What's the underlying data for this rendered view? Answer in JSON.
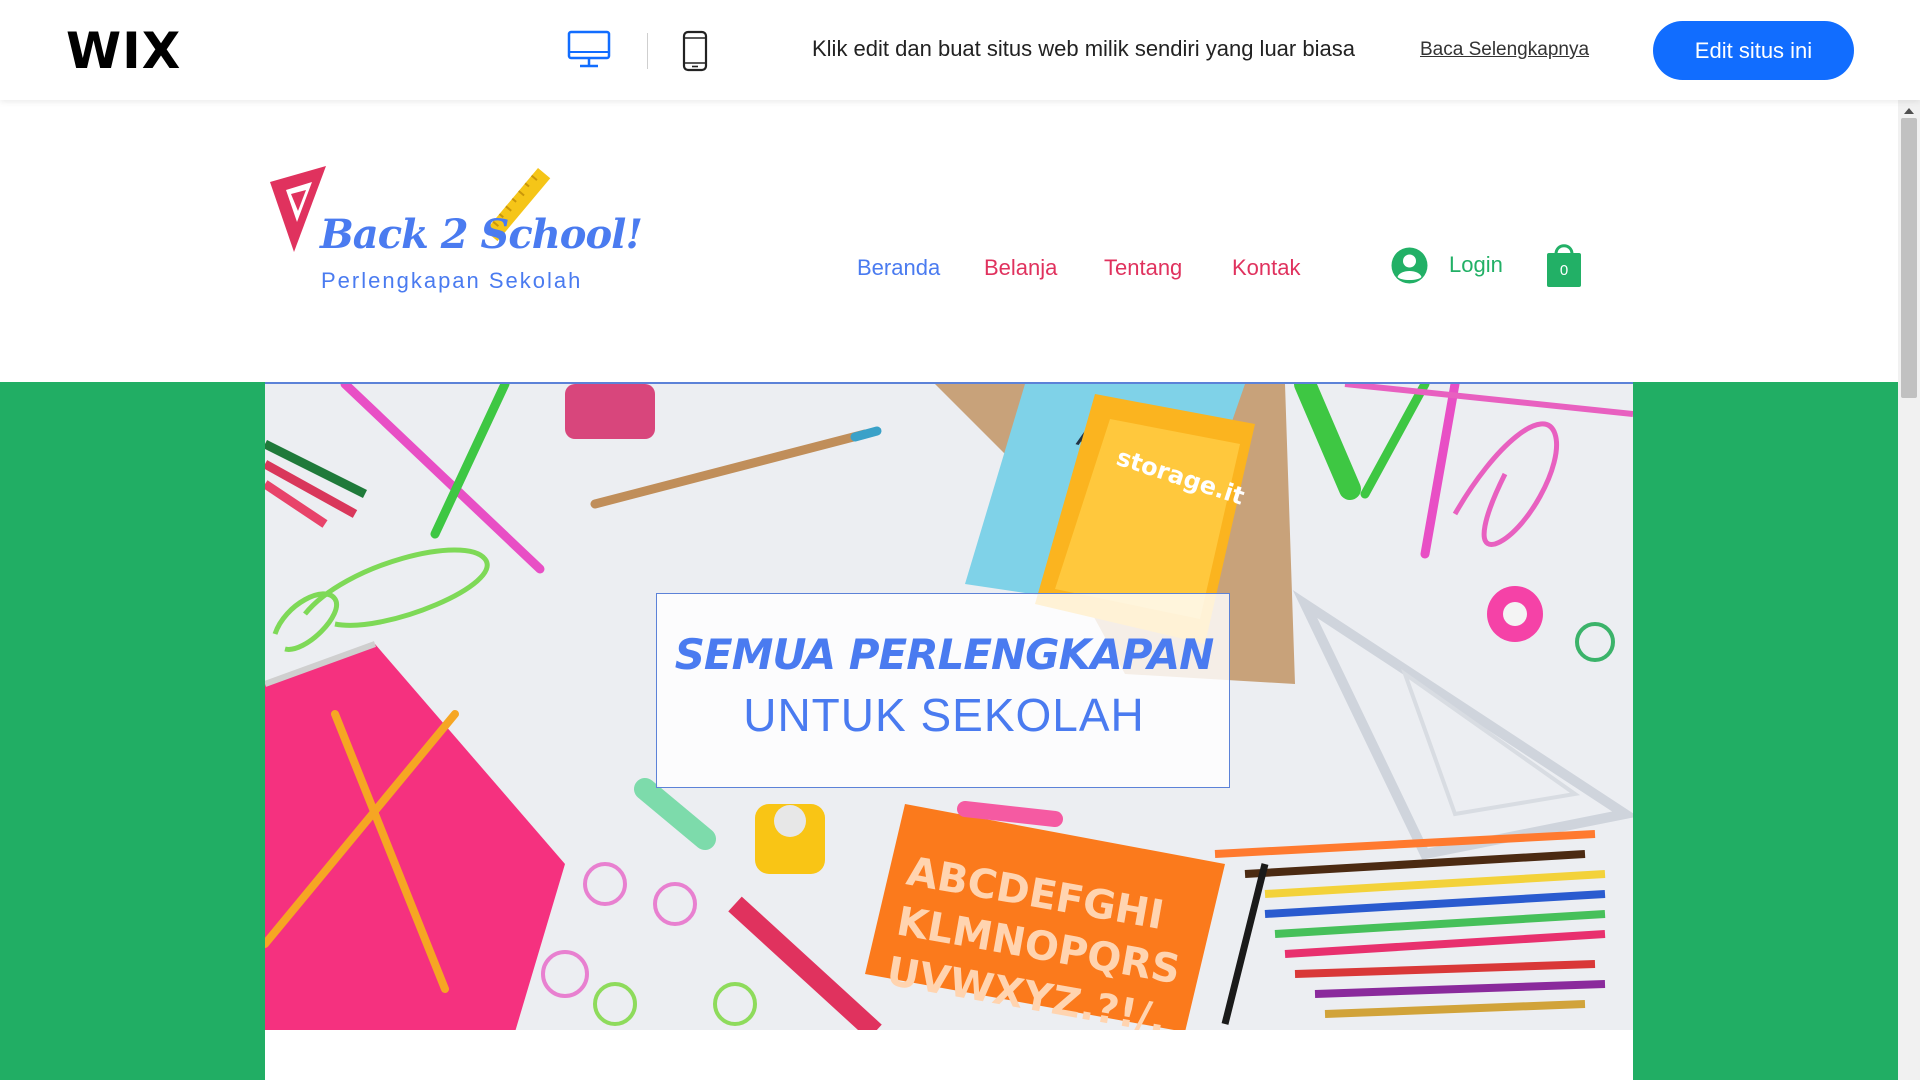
{
  "wix_bar": {
    "logo": "WIX",
    "promo_text": "Klik edit dan buat situs web milik sendiri yang luar biasa",
    "read_more": "Baca Selengkapnya",
    "edit_button": "Edit situs ini",
    "accent_color": "#116dff"
  },
  "site": {
    "title": "Back 2 School!",
    "tagline": "Perlengkapan Sekolah",
    "nav": [
      {
        "label": "Beranda",
        "color": "#4a7bf0"
      },
      {
        "label": "Belanja",
        "color": "#e0325e"
      },
      {
        "label": "Tentang",
        "color": "#e0325e"
      },
      {
        "label": "Kontak",
        "color": "#e0325e"
      }
    ],
    "login_label": "Login",
    "cart_count": "0",
    "brand_green": "#21ae64",
    "brand_blue": "#4a7bf0"
  },
  "hero": {
    "headline_line1": "SEMUA PERLENGKAPAN",
    "headline_line2": "UNTUK SEKOLAH"
  }
}
